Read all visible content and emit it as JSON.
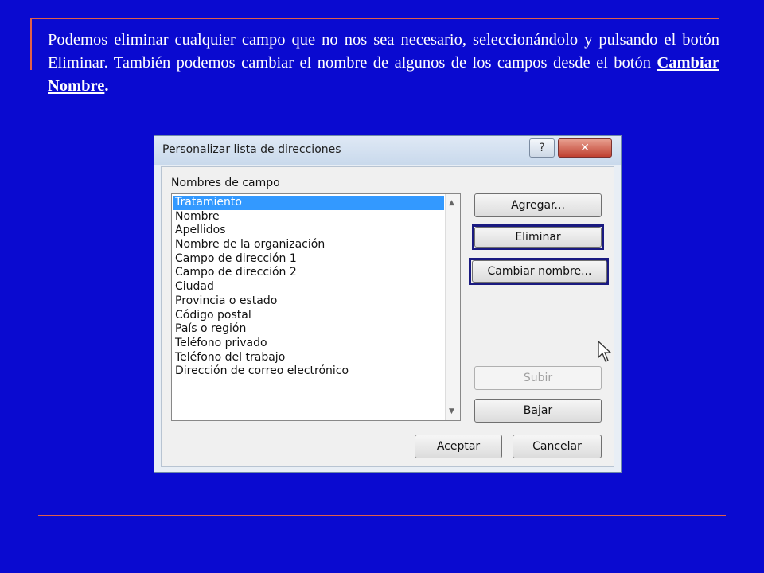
{
  "slide": {
    "text_part1": "Podemos eliminar cualquier campo que no nos sea necesario, seleccionándolo y pulsando el botón  Eliminar. También podemos cambiar el nombre de algunos de los campos desde el botón ",
    "text_link": "Cambiar Nombre",
    "text_end": "."
  },
  "dialog": {
    "title": "Personalizar lista de direcciones",
    "help_label": "?",
    "close_label": "✕",
    "fields_label": "Nombres de campo",
    "fields": [
      "Tratamiento",
      "Nombre",
      "Apellidos",
      "Nombre de la organización",
      "Campo de dirección 1",
      "Campo de dirección 2",
      "Ciudad",
      "Provincia o estado",
      "Código postal",
      "País o región",
      "Teléfono privado",
      "Teléfono del trabajo",
      "Dirección de correo electrónico"
    ],
    "selected_field": "Tratamiento",
    "buttons": {
      "add": "Agregar...",
      "delete": "Eliminar",
      "rename": "Cambiar nombre...",
      "up": "Subir",
      "down": "Bajar",
      "ok": "Aceptar",
      "cancel": "Cancelar"
    }
  },
  "icons": {
    "scroll_up": "scroll-up-arrow-icon",
    "scroll_down": "scroll-down-arrow-icon",
    "cursor": "mouse-pointer-icon"
  },
  "colors": {
    "background": "#0a0ad0",
    "rule": "#e0604a",
    "selection": "#3399ff",
    "highlight_box": "#1a1a80"
  }
}
